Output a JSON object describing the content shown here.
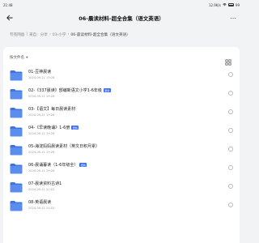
{
  "status": {
    "time": "21:48",
    "network": "12.9K/s",
    "battery": "99"
  },
  "header": {
    "title": "06-晨读材料-超全合集（语文英语）"
  },
  "breadcrumb": [
    "夸克网盘",
    "来自：分享",
    "03-小学",
    "06-晨读材料-超全合集（语文英语）"
  ],
  "sort": {
    "label": "按文件名"
  },
  "files": [
    {
      "name": "01-豆神晨读",
      "date": "2024-09-11 19:28",
      "badge": ""
    },
    {
      "name": "02-《337晨读》部编新语文小学1-6年级",
      "date": "2024-09-11 19:26",
      "badge": "更新"
    },
    {
      "name": "03-【语文】每日晨读素材",
      "date": "2024-09-11 19:26",
      "badge": ""
    },
    {
      "name": "04-《早读晚诵》1-6册",
      "date": "2024-09-11 19:26",
      "badge": "更新"
    },
    {
      "name": "05-海淀妈妈晨读素材（英文日积月累）",
      "date": "2024-09-11 19:26",
      "badge": ""
    },
    {
      "name": "06-晨诵暮读（1-6年级全）",
      "date": "2024-09-11 19:26",
      "badge": "更新"
    },
    {
      "name": "07-晨读资料古诗1",
      "date": "2024-09-11 21:02",
      "badge": ""
    },
    {
      "name": "08-英语晨读",
      "date": "2024-09-11 21:02",
      "badge": ""
    }
  ],
  "colors": {
    "folder": "#5b8def",
    "folder_tab": "#3f74e0",
    "badge": "#3a6cf5"
  }
}
